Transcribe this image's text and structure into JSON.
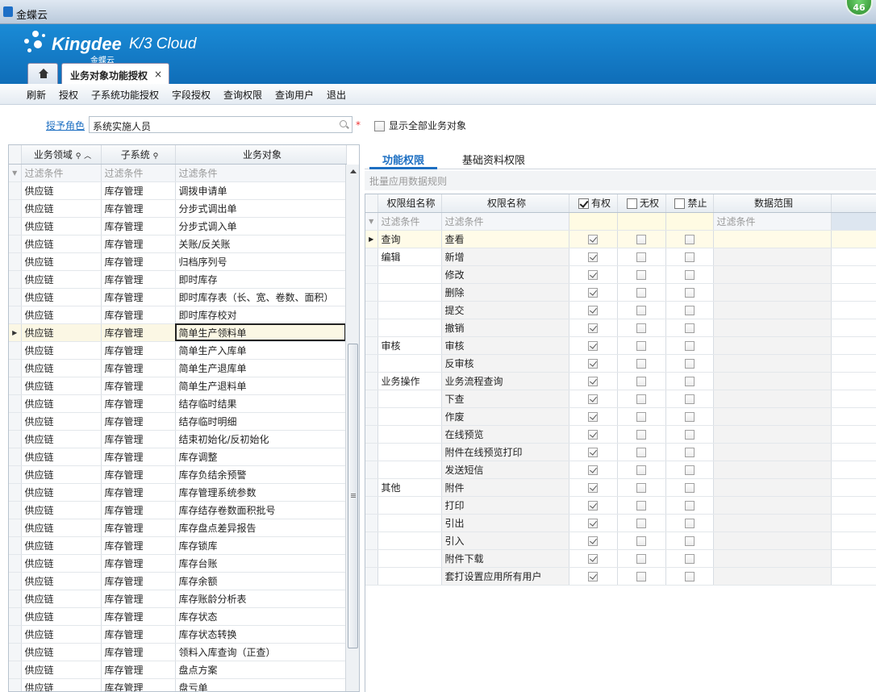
{
  "window": {
    "title": "金蝶云",
    "badge": "46"
  },
  "brand": {
    "logo": "Kingdee",
    "logo_cn": "金蝶云",
    "product": "K/3 Cloud"
  },
  "tabs": {
    "doc_tab": "业务对象功能授权",
    "close": "×"
  },
  "toolbar": [
    "刷新",
    "授权",
    "子系统功能授权",
    "字段授权",
    "查询权限",
    "查询用户",
    "退出"
  ],
  "role": {
    "label": "授予角色",
    "value": "系统实施人员",
    "required_mark": "*"
  },
  "show_all": {
    "label": "显示全部业务对象",
    "checked": false
  },
  "left_grid": {
    "headers": [
      "业务领域",
      "子系统",
      "业务对象"
    ],
    "filter": [
      "过滤条件",
      "过滤条件",
      "过滤条件"
    ],
    "selected_index": 8,
    "rows": [
      [
        "供应链",
        "库存管理",
        "调拨申请单"
      ],
      [
        "供应链",
        "库存管理",
        "分步式调出单"
      ],
      [
        "供应链",
        "库存管理",
        "分步式调入单"
      ],
      [
        "供应链",
        "库存管理",
        "关账/反关账"
      ],
      [
        "供应链",
        "库存管理",
        "归档序列号"
      ],
      [
        "供应链",
        "库存管理",
        "即时库存"
      ],
      [
        "供应链",
        "库存管理",
        "即时库存表（长、宽、卷数、面积）"
      ],
      [
        "供应链",
        "库存管理",
        "即时库存校对"
      ],
      [
        "供应链",
        "库存管理",
        "简单生产领料单"
      ],
      [
        "供应链",
        "库存管理",
        "简单生产入库单"
      ],
      [
        "供应链",
        "库存管理",
        "简单生产退库单"
      ],
      [
        "供应链",
        "库存管理",
        "简单生产退料单"
      ],
      [
        "供应链",
        "库存管理",
        "结存临时结果"
      ],
      [
        "供应链",
        "库存管理",
        "结存临时明细"
      ],
      [
        "供应链",
        "库存管理",
        "结束初始化/反初始化"
      ],
      [
        "供应链",
        "库存管理",
        "库存调整"
      ],
      [
        "供应链",
        "库存管理",
        "库存负结余预警"
      ],
      [
        "供应链",
        "库存管理",
        "库存管理系统参数"
      ],
      [
        "供应链",
        "库存管理",
        "库存结存卷数面积批号"
      ],
      [
        "供应链",
        "库存管理",
        "库存盘点差异报告"
      ],
      [
        "供应链",
        "库存管理",
        "库存锁库"
      ],
      [
        "供应链",
        "库存管理",
        "库存台账"
      ],
      [
        "供应链",
        "库存管理",
        "库存余额"
      ],
      [
        "供应链",
        "库存管理",
        "库存账龄分析表"
      ],
      [
        "供应链",
        "库存管理",
        "库存状态"
      ],
      [
        "供应链",
        "库存管理",
        "库存状态转换"
      ],
      [
        "供应链",
        "库存管理",
        "领料入库查询（正查）"
      ],
      [
        "供应链",
        "库存管理",
        "盘点方案"
      ],
      [
        "供应链",
        "库存管理",
        "盘亏单"
      ]
    ]
  },
  "right_tabs": [
    "功能权限",
    "基础资料权限"
  ],
  "batch_rule": "批量应用数据规则",
  "perm_grid": {
    "headers": {
      "group": "权限组名称",
      "name": "权限名称",
      "allow": "有权",
      "none": "无权",
      "deny": "禁止",
      "scope": "数据范围"
    },
    "header_checks": {
      "allow": true,
      "none": false,
      "deny": false
    },
    "filter": {
      "group": "过滤条件",
      "name": "过滤条件",
      "scope": "过滤条件"
    },
    "rows": [
      {
        "group": "查询",
        "name": "查看",
        "allow": true,
        "none": false,
        "deny": false
      },
      {
        "group": "编辑",
        "name": "新增",
        "allow": true,
        "none": false,
        "deny": false
      },
      {
        "group": "",
        "name": "修改",
        "allow": true,
        "none": false,
        "deny": false
      },
      {
        "group": "",
        "name": "删除",
        "allow": true,
        "none": false,
        "deny": false
      },
      {
        "group": "",
        "name": "提交",
        "allow": true,
        "none": false,
        "deny": false
      },
      {
        "group": "",
        "name": "撤销",
        "allow": true,
        "none": false,
        "deny": false
      },
      {
        "group": "审核",
        "name": "审核",
        "allow": true,
        "none": false,
        "deny": false
      },
      {
        "group": "",
        "name": "反审核",
        "allow": true,
        "none": false,
        "deny": false
      },
      {
        "group": "业务操作",
        "name": "业务流程查询",
        "allow": true,
        "none": false,
        "deny": false
      },
      {
        "group": "",
        "name": "下查",
        "allow": true,
        "none": false,
        "deny": false
      },
      {
        "group": "",
        "name": "作废",
        "allow": true,
        "none": false,
        "deny": false
      },
      {
        "group": "",
        "name": "在线预览",
        "allow": true,
        "none": false,
        "deny": false
      },
      {
        "group": "",
        "name": "附件在线预览打印",
        "allow": true,
        "none": false,
        "deny": false
      },
      {
        "group": "",
        "name": "发送短信",
        "allow": true,
        "none": false,
        "deny": false
      },
      {
        "group": "其他",
        "name": "附件",
        "allow": true,
        "none": false,
        "deny": false
      },
      {
        "group": "",
        "name": "打印",
        "allow": true,
        "none": false,
        "deny": false
      },
      {
        "group": "",
        "name": "引出",
        "allow": true,
        "none": false,
        "deny": false
      },
      {
        "group": "",
        "name": "引入",
        "allow": true,
        "none": false,
        "deny": false
      },
      {
        "group": "",
        "name": "附件下载",
        "allow": true,
        "none": false,
        "deny": false
      },
      {
        "group": "",
        "name": "套打设置应用所有用户",
        "allow": true,
        "none": false,
        "deny": false
      }
    ]
  },
  "colors": {
    "brand_blue": "#1a8bd6",
    "link_blue": "#1d6fc2",
    "selected_row": "#fbf7e4"
  }
}
